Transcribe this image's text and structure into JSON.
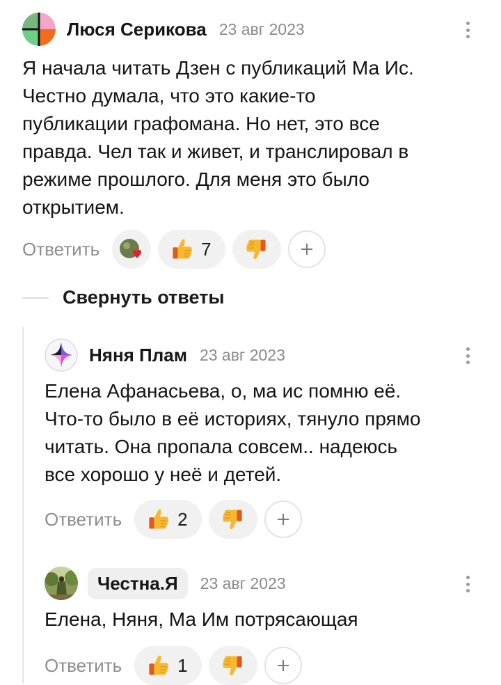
{
  "comments": [
    {
      "author": "Люся Серикова",
      "date": "23 авг 2023",
      "text": "Я начала читать Дзен с публикаций Ма Ис.\nЧестно думала, что это какие-то\nпубликации графомана. Но нет, это все\nправда. Чел так и живет, и транслировал в\nрежиме прошлого. Для меня это было\nоткрытием.",
      "reply_label": "Ответить",
      "likes": "7",
      "avatar_icon": "multicolor-circle-avatar",
      "reaction_icon": "heart-reaction-icon"
    }
  ],
  "collapse_label": "Свернуть ответы",
  "replies": [
    {
      "author": "Няня Плам",
      "date": "23 авг 2023",
      "text": "Елена Афанасьева, о, ма ис помню её.\nЧто-то было в её историях, тянуло прямо\nчитать. Она пропала совсем.. надеюсь\nвсе хорошо у неё и детей.",
      "reply_label": "Ответить",
      "likes": "2",
      "avatar_icon": "star-circle-avatar"
    },
    {
      "author": "Честна.Я",
      "date": "23 авг 2023",
      "text": "Елена, Няня, Ма Им потрясающая",
      "reply_label": "Ответить",
      "likes": "1",
      "avatar_icon": "photo-avatar"
    }
  ],
  "icons": {
    "like": "thumbs-up-emoji",
    "dislike": "thumbs-down-emoji",
    "add_reaction": "plus-icon",
    "more": "vertical-ellipsis-icon"
  },
  "colors": {
    "thumb": "#f5b82e",
    "pill_bg": "#f1f1f1",
    "muted_text": "#8d8d8d"
  }
}
